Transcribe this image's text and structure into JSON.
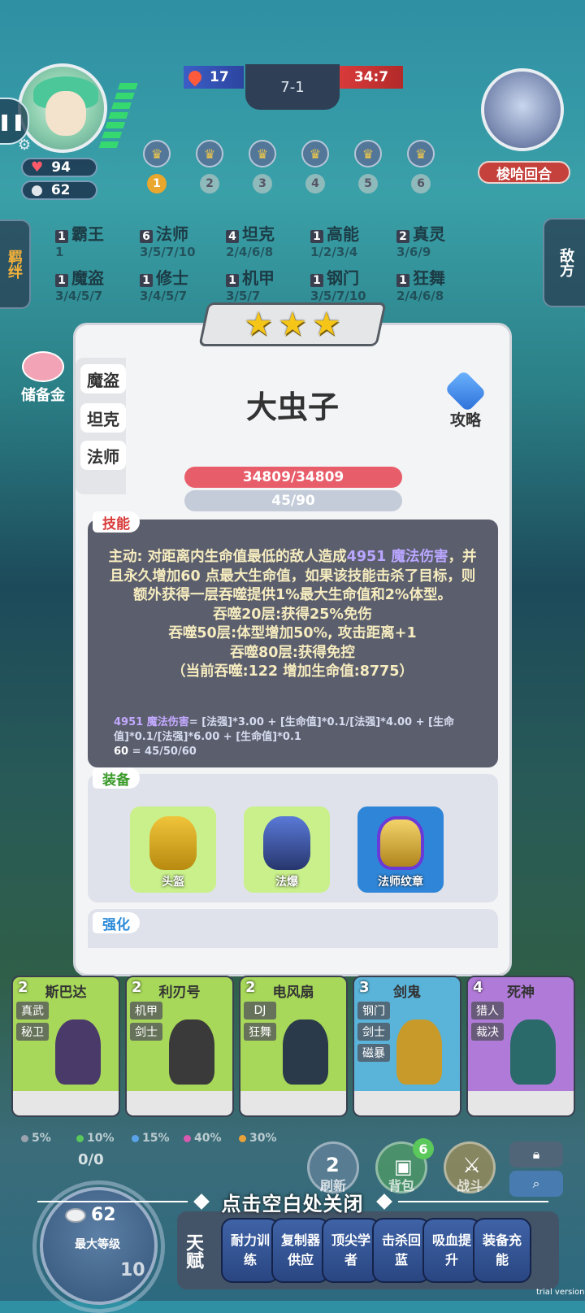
{
  "hud": {
    "hp": "94",
    "gold": "62",
    "score_left": "17",
    "round": "7-1",
    "score_right": "34:7",
    "enemy_name": "梭哈回合",
    "round_steps": [
      "1",
      "2",
      "3",
      "4",
      "5",
      "6"
    ],
    "side_left": "羁绊",
    "side_right": "敌方",
    "savings_label": "储备金"
  },
  "synergies": [
    {
      "count": "1",
      "name": "霸王",
      "levels": "1"
    },
    {
      "count": "6",
      "name": "法师",
      "levels": "3/5/7/10"
    },
    {
      "count": "4",
      "name": "坦克",
      "levels": "2/4/6/8"
    },
    {
      "count": "1",
      "name": "高能",
      "levels": "1/2/3/4"
    },
    {
      "count": "2",
      "name": "真灵",
      "levels": "3/6/9"
    },
    {
      "count": "1",
      "name": "魔盗",
      "levels": "3/4/5/7"
    },
    {
      "count": "1",
      "name": "修士",
      "levels": "3/4/5/7"
    },
    {
      "count": "1",
      "name": "机甲",
      "levels": "3/5/7"
    },
    {
      "count": "1",
      "name": "钢门",
      "levels": "3/5/7/10"
    },
    {
      "count": "1",
      "name": "狂舞",
      "levels": "2/4/6/8"
    }
  ],
  "hero": {
    "stars": 3,
    "name": "大虫子",
    "traits": [
      "魔盗",
      "坦克",
      "法师"
    ],
    "guide_label": "攻略",
    "hp_text": "34809/34809",
    "mp_text": "45/90",
    "hp_fraction": 1.0,
    "mp_fraction": 0.5,
    "skill_title": "技能",
    "skill_line1_a": "主动: 对距离内生命值最低的敌人造成",
    "skill_line1_b": "4951 魔法伤害",
    "skill_line2": "，并且永久增加60 点最大生命值，如果该技能击杀了目标，则额外获得一层吞噬提供1%最大生命值和2%体型。",
    "skill_line3": "吞噬20层:获得25%免伤",
    "skill_line4": "吞噬50层:体型增加50%, 攻击距离+1",
    "skill_line5": "吞噬80层:获得免控",
    "skill_line6": "（当前吞噬:122 增加生命值:8775）",
    "formula_a": "4951 魔法伤害",
    "formula_b": "= [法强]*3.00 + [生命值]*0.1/[法强]*4.00 + [生命值]*0.1/[法强]*6.00 + [生命值]*0.1",
    "formula_c": "60",
    "formula_d": "= 45/50/60",
    "equip_title": "装备",
    "equipment": [
      "头盔",
      "法爆",
      "法师纹章"
    ],
    "enhance_title": "强化"
  },
  "shop": [
    {
      "cost": "2",
      "name": "斯巴达",
      "tags": [
        "真武",
        "秘卫"
      ],
      "color": "#a7d85a"
    },
    {
      "cost": "2",
      "name": "利刃号",
      "tags": [
        "机甲",
        "剑士"
      ],
      "color": "#a7d85a"
    },
    {
      "cost": "2",
      "name": "电风扇",
      "tags": [
        "DJ",
        "狂舞"
      ],
      "color": "#a7d85a"
    },
    {
      "cost": "3",
      "name": "剑鬼",
      "tags": [
        "钢门",
        "剑士",
        "磁暴"
      ],
      "color": "#5ab3d8"
    },
    {
      "cost": "4",
      "name": "死神",
      "tags": [
        "猎人",
        "裁决"
      ],
      "color": "#b07ad8"
    }
  ],
  "odds": [
    {
      "pct": "5%",
      "color": "#9aa3ad"
    },
    {
      "pct": "10%",
      "color": "#5ac85a"
    },
    {
      "pct": "15%",
      "color": "#5aa3e8"
    },
    {
      "pct": "40%",
      "color": "#d85ab0"
    },
    {
      "pct": "30%",
      "color": "#e8a23a"
    }
  ],
  "bottom": {
    "xp": "0/0",
    "gold": "62",
    "max_level": "最大等级",
    "level": "10",
    "refresh_cost": "2",
    "refresh_label": "刷新",
    "bag_label": "背包",
    "bag_count": "6",
    "battle_label": "战斗",
    "close_hint": "点击空白处关闭",
    "talent_label": "天赋",
    "talents": [
      "耐力训练",
      "复制器供应",
      "顶尖学者",
      "击杀回蓝",
      "吸血提升",
      "装备充能"
    ],
    "trial": "trial version"
  }
}
